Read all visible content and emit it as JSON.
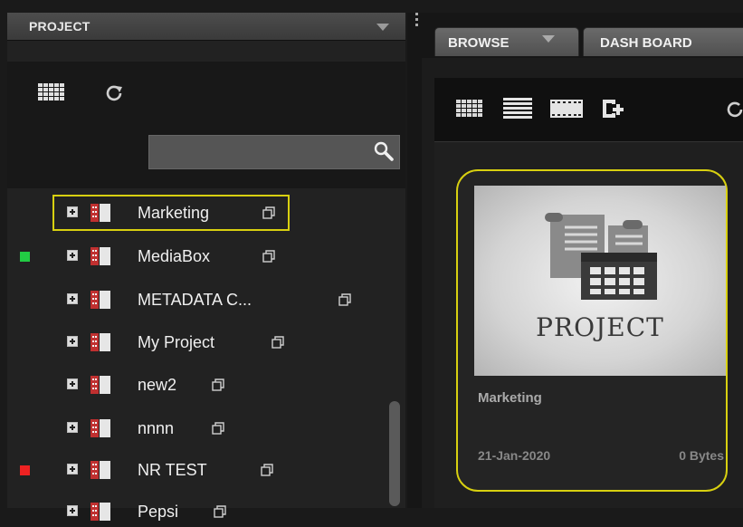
{
  "left_panel": {
    "title": "PROJECT",
    "search": {
      "value": "",
      "placeholder": ""
    },
    "tree_items": [
      {
        "label": "Marketing",
        "status": "",
        "selected": true
      },
      {
        "label": "MediaBox",
        "status": "#22cc44",
        "selected": false
      },
      {
        "label": "METADATA C...",
        "status": "",
        "selected": false
      },
      {
        "label": "My Project",
        "status": "",
        "selected": false
      },
      {
        "label": "new2",
        "status": "",
        "selected": false
      },
      {
        "label": "nnnn",
        "status": "",
        "selected": false
      },
      {
        "label": "NR TEST",
        "status": "#ee2222",
        "selected": false
      },
      {
        "label": "Pepsi",
        "status": "",
        "selected": false
      }
    ]
  },
  "right_panel": {
    "tabs": [
      {
        "label": "BROWSE",
        "has_dropdown": true
      },
      {
        "label": "DASH BOARD",
        "has_dropdown": false
      }
    ],
    "toolbar_icons": [
      "grid-view-icon",
      "list-view-icon",
      "filmstrip-view-icon",
      "add-folder-icon",
      "refresh-icon"
    ],
    "card": {
      "thumbnail_label": "PROJECT",
      "name": "Marketing",
      "date": "21-Jan-2020",
      "size": "0 Bytes"
    }
  },
  "colors": {
    "selection": "#d8d010",
    "status_green": "#22cc44",
    "status_red": "#ee2222"
  }
}
